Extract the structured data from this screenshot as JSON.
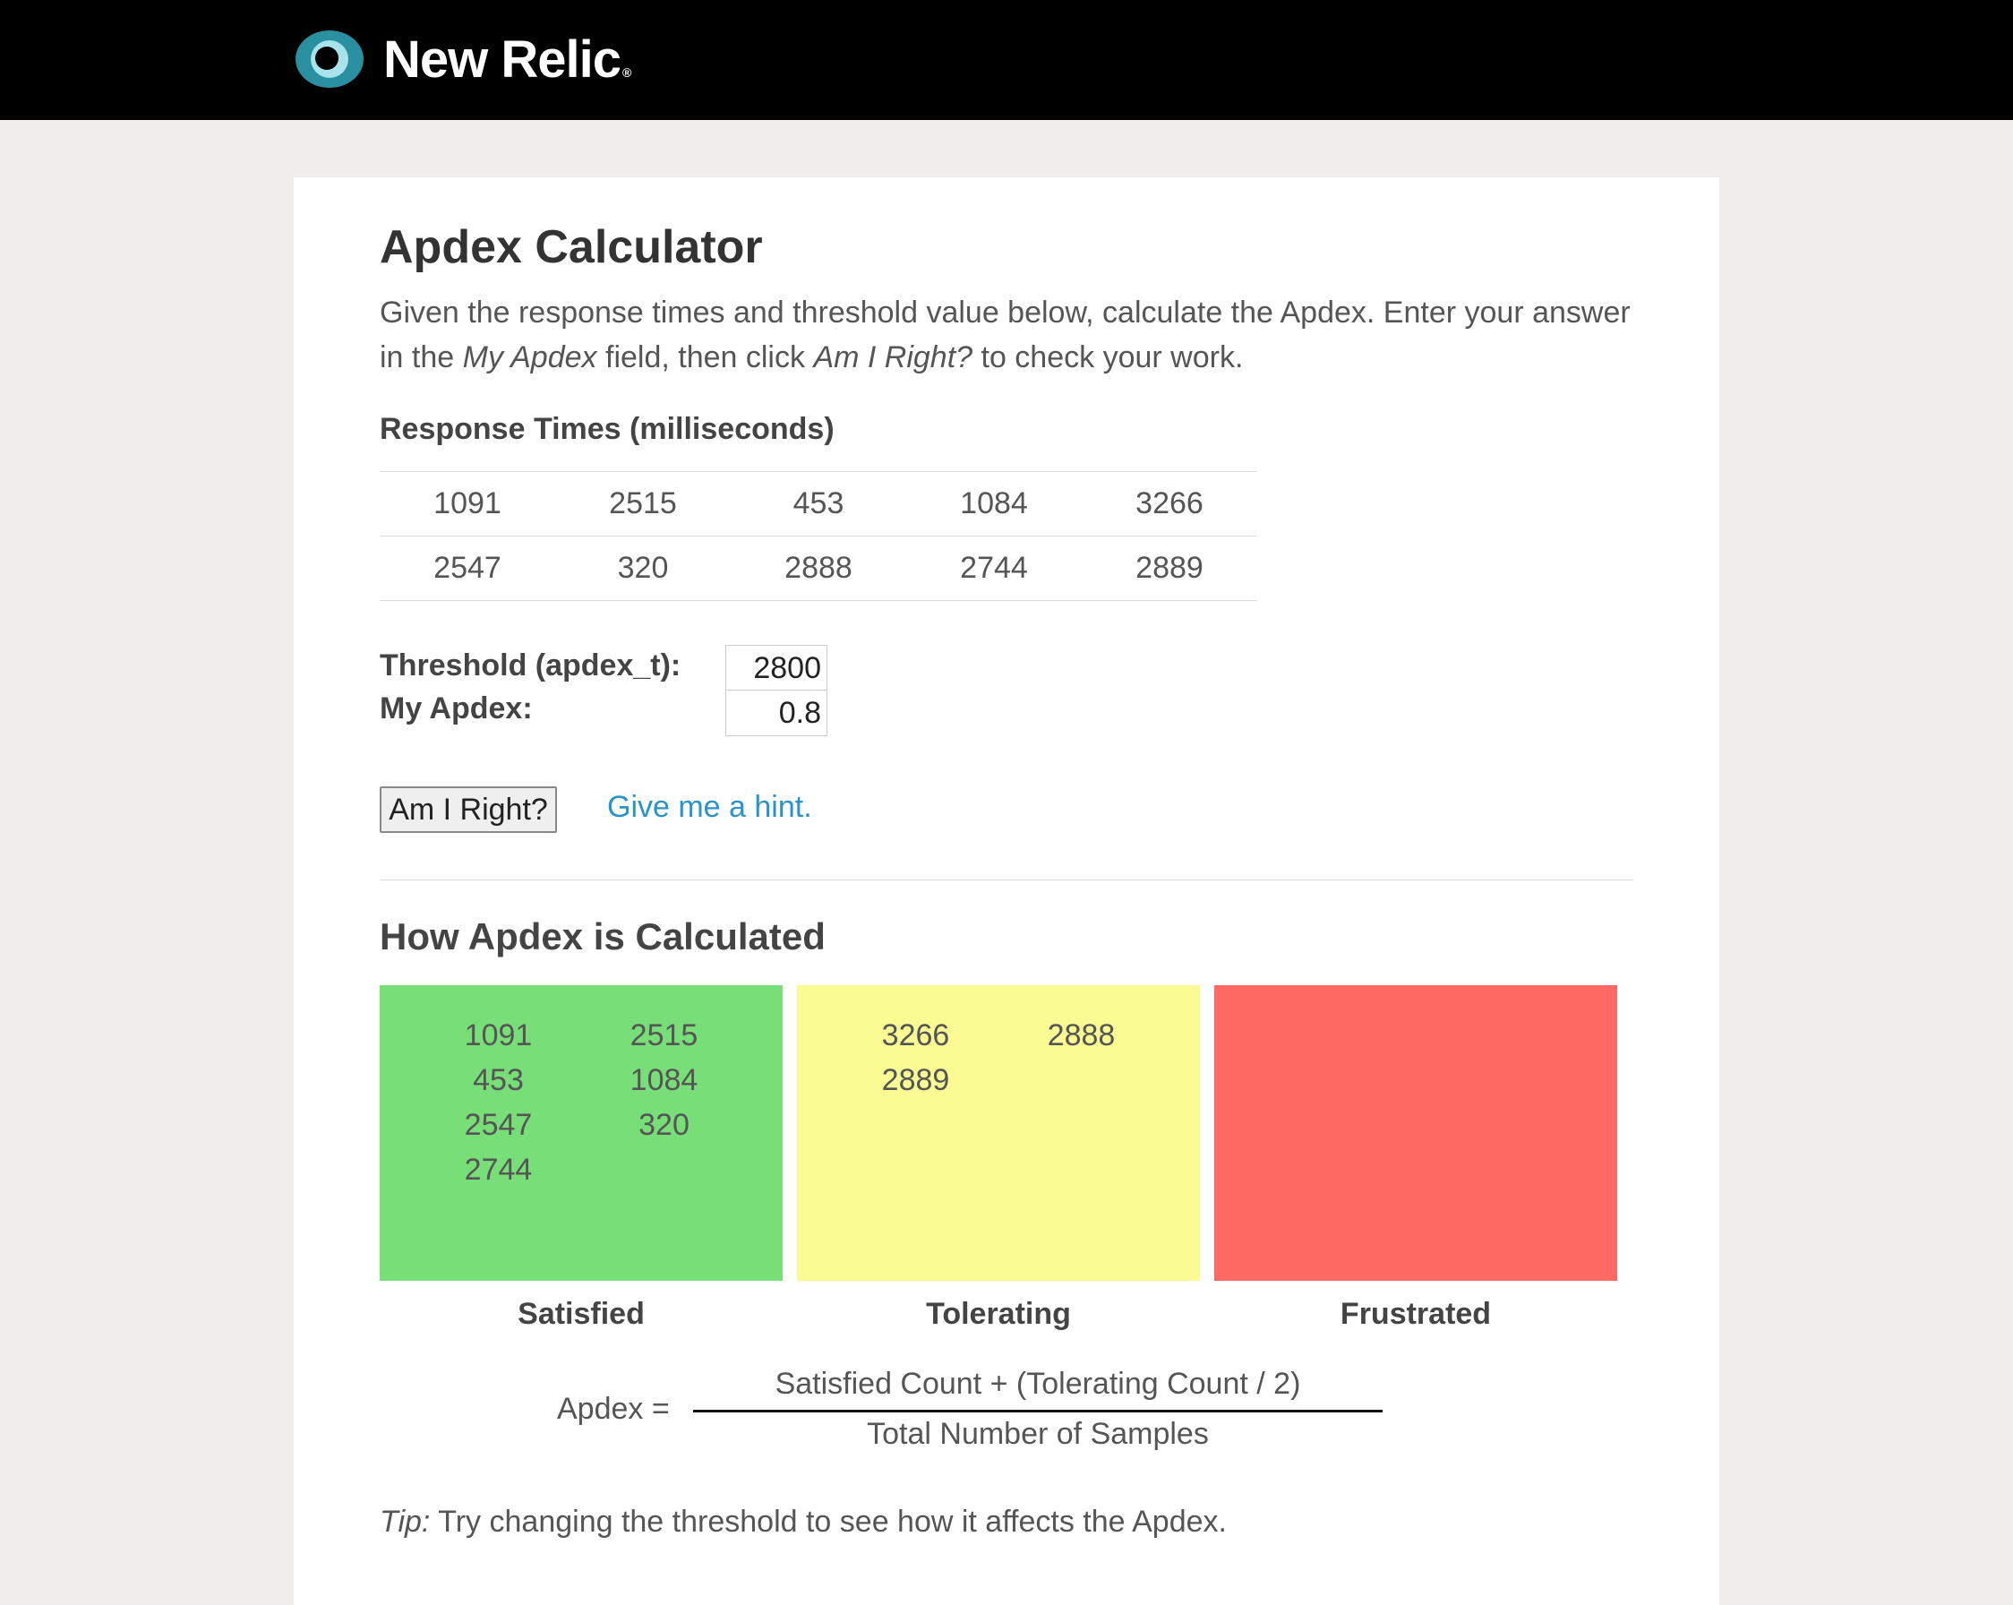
{
  "brand": {
    "name": "New Relic",
    "reg": "®"
  },
  "page": {
    "title": "Apdex Calculator",
    "intro": {
      "part1": "Given the response times and threshold value below, calculate the Apdex. Enter your answer in the ",
      "field_name": "My Apdex",
      "part2": " field, then click ",
      "button_name": "Am I Right?",
      "part3": " to check your work."
    }
  },
  "response_times": {
    "title": "Response Times (milliseconds)",
    "rows": [
      [
        "1091",
        "2515",
        "453",
        "1084",
        "3266"
      ],
      [
        "2547",
        "320",
        "2888",
        "2744",
        "2889"
      ]
    ]
  },
  "form": {
    "threshold_label": "Threshold (apdex_t):",
    "threshold_value": "2800",
    "my_apdex_label": "My Apdex:",
    "my_apdex_value": "0.8",
    "submit_label": "Am I Right?",
    "hint_link": "Give me a hint."
  },
  "how": {
    "title": "How Apdex is Calculated",
    "satisfied": {
      "label": "Satisfied",
      "color": "#78de78",
      "values": [
        "1091",
        "2515",
        "453",
        "1084",
        "2547",
        "320",
        "2744"
      ]
    },
    "tolerating": {
      "label": "Tolerating",
      "color": "#fbfb94",
      "values": [
        "3266",
        "2888",
        "2889"
      ]
    },
    "frustrated": {
      "label": "Frustrated",
      "color": "#ff6964",
      "values": []
    },
    "formula": {
      "lhs": "Apdex =",
      "numerator": "Satisfied Count + (Tolerating Count / 2)",
      "denominator": "Total Number of Samples"
    },
    "tip": {
      "label": "Tip:",
      "text": " Try changing the threshold to see how it affects the Apdex."
    }
  }
}
